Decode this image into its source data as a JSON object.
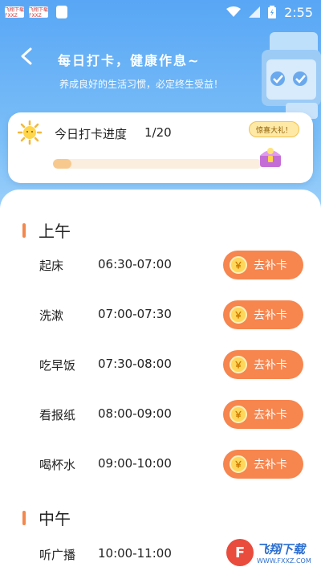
{
  "status_bar": {
    "left_badges": [
      "飞翔下载 FXXZ",
      "飞翔下载 FXXZ"
    ],
    "time": "2:55"
  },
  "header": {
    "title": "每日打卡，健康作息~",
    "subtitle": "养成良好的生活习惯，必定终生受益！"
  },
  "progress": {
    "label": "今日打卡进度",
    "count": "1/20",
    "fraction": 0.09,
    "gift_bubble": "惊喜大礼！"
  },
  "sections": [
    {
      "title": "上午",
      "rows": [
        {
          "name": "起床",
          "time": "06:30-07:00",
          "button": "去补卡",
          "coin": "￥"
        },
        {
          "name": "洗漱",
          "time": "07:00-07:30",
          "button": "去补卡",
          "coin": "￥"
        },
        {
          "name": "吃早饭",
          "time": "07:30-08:00",
          "button": "去补卡",
          "coin": "￥"
        },
        {
          "name": "看报纸",
          "time": "08:00-09:00",
          "button": "去补卡",
          "coin": "￥"
        },
        {
          "name": "喝杯水",
          "time": "09:00-10:00",
          "button": "去补卡",
          "coin": "￥"
        }
      ]
    },
    {
      "title": "中午",
      "rows": [
        {
          "name": "听广播",
          "time": "10:00-11:00",
          "button": "去补卡",
          "coin": "￥"
        }
      ]
    }
  ],
  "watermark": {
    "text": "飞翔下载",
    "url": "WWW.FXXZ.COM",
    "logo_letter": "F"
  },
  "colors": {
    "hero_top": "#58a6f5",
    "accent_button": "#f7854e",
    "section_bar": "#f2884b",
    "progress_fill": "#f7c98f"
  }
}
